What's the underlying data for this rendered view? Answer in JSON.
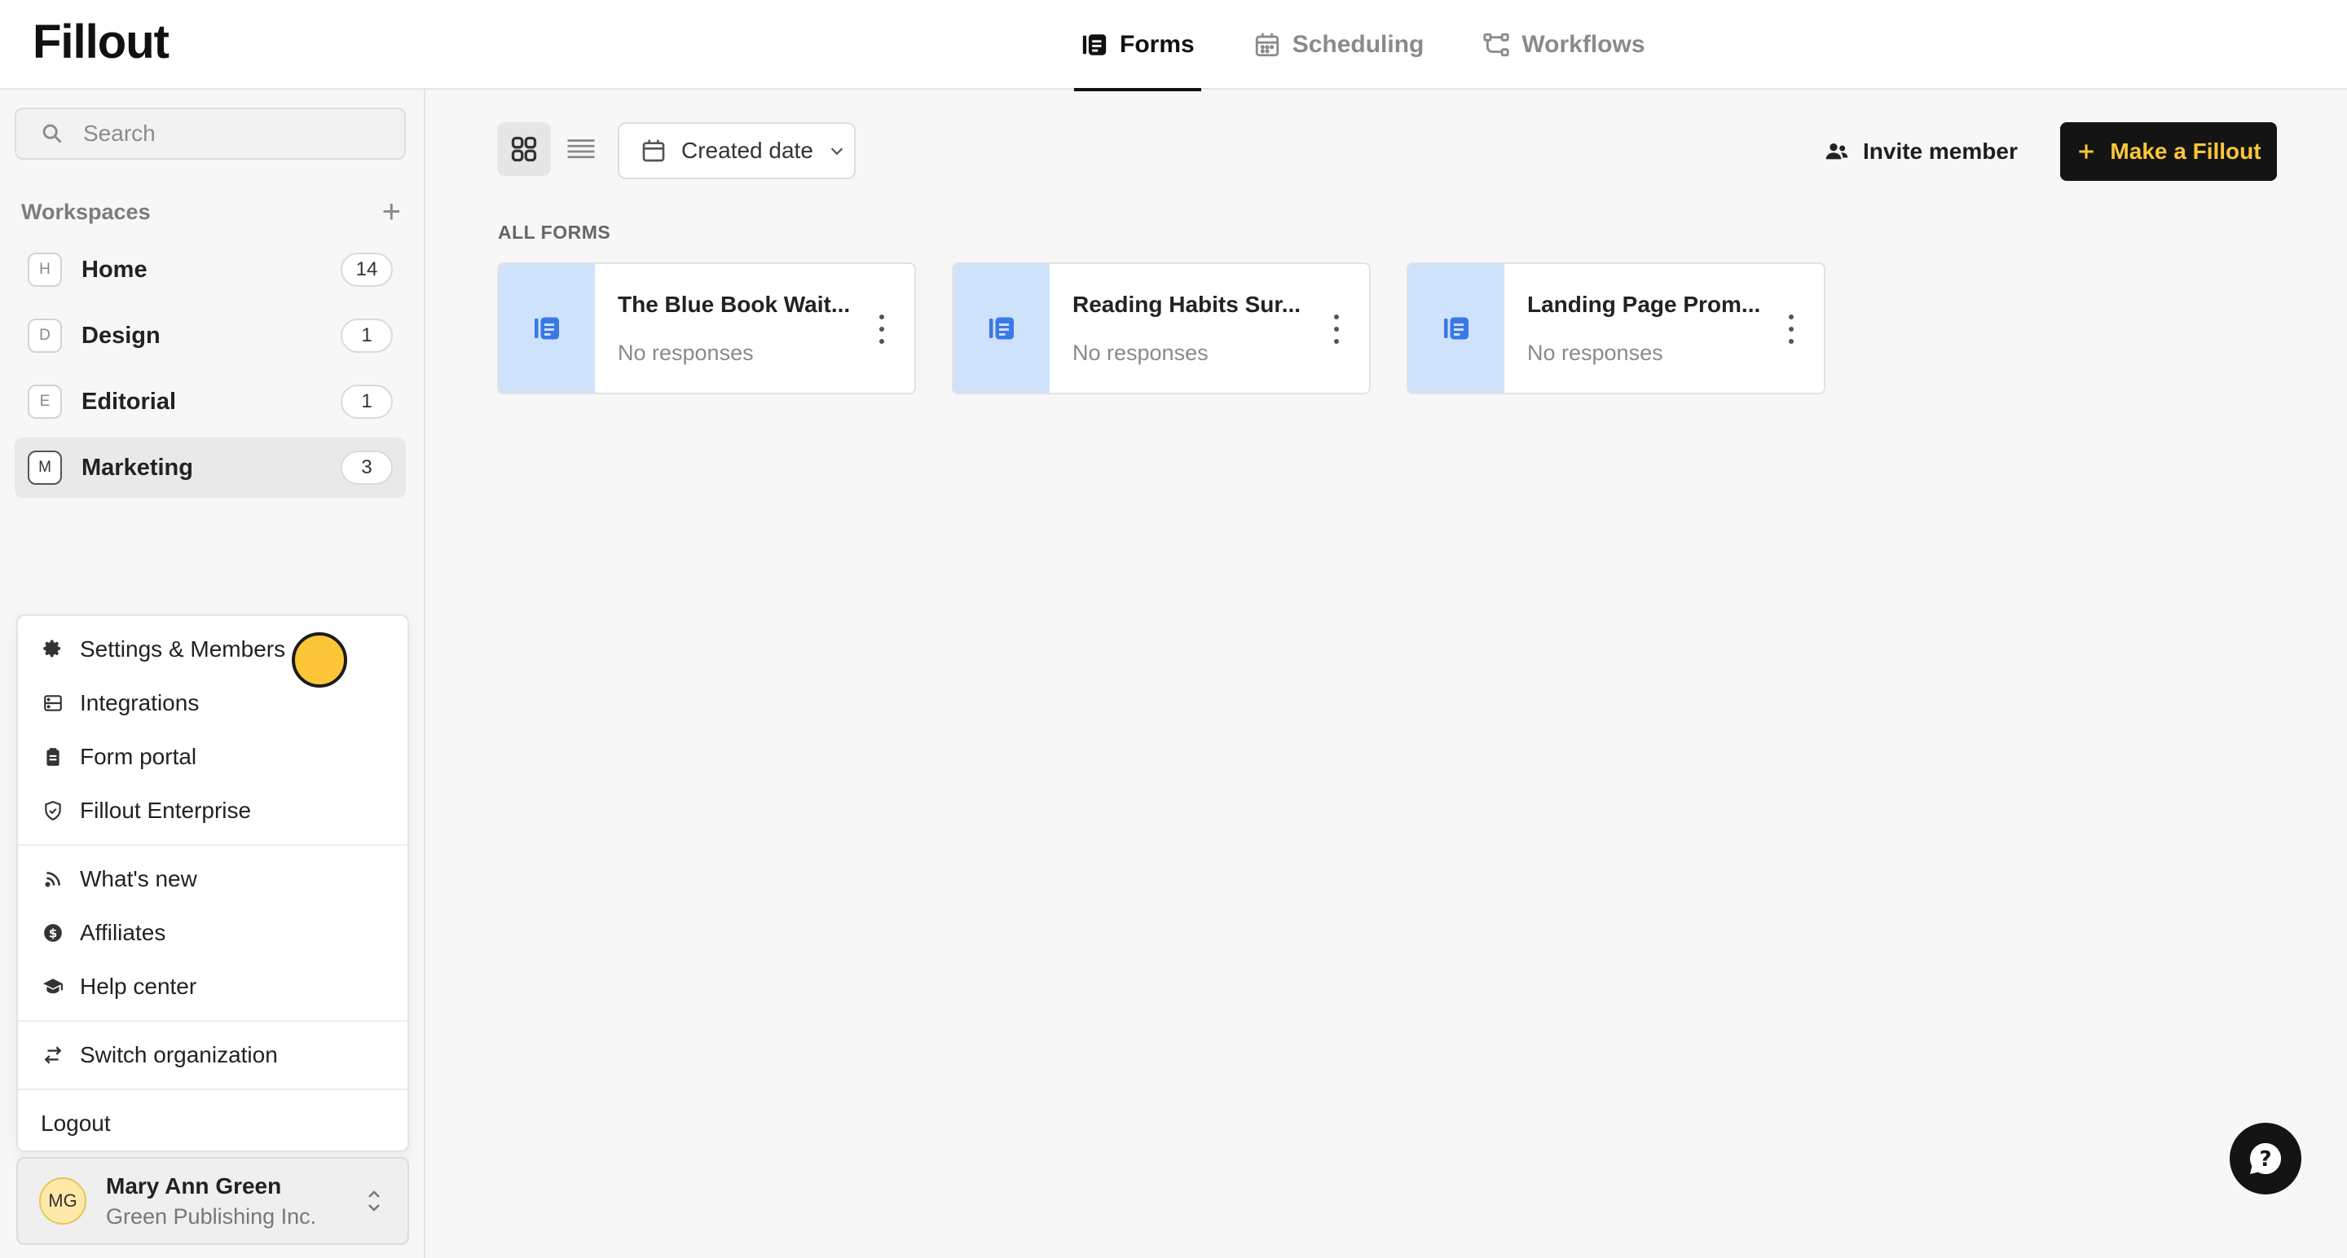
{
  "app": {
    "logo": "Fillout"
  },
  "nav": {
    "tabs": [
      {
        "label": "Forms",
        "icon": "form-icon",
        "active": true
      },
      {
        "label": "Scheduling",
        "icon": "calendar-icon",
        "active": false
      },
      {
        "label": "Workflows",
        "icon": "workflow-icon",
        "active": false
      }
    ]
  },
  "sidebar": {
    "search": {
      "placeholder": "Search"
    },
    "workspaces_title": "Workspaces",
    "workspaces": [
      {
        "letter": "H",
        "name": "Home",
        "count": "14",
        "active": false
      },
      {
        "letter": "D",
        "name": "Design",
        "count": "1",
        "active": false
      },
      {
        "letter": "E",
        "name": "Editorial",
        "count": "1",
        "active": false
      },
      {
        "letter": "M",
        "name": "Marketing",
        "count": "3",
        "active": true
      }
    ]
  },
  "menu": {
    "groups": [
      [
        {
          "label": "Settings & Members",
          "icon": "gear-icon"
        },
        {
          "label": "Integrations",
          "icon": "integrations-icon"
        },
        {
          "label": "Form portal",
          "icon": "clipboard-icon"
        },
        {
          "label": "Fillout Enterprise",
          "icon": "shield-icon"
        }
      ],
      [
        {
          "label": "What's new",
          "icon": "rss-icon"
        },
        {
          "label": "Affiliates",
          "icon": "dollar-icon"
        },
        {
          "label": "Help center",
          "icon": "graduation-cap-icon"
        }
      ],
      [
        {
          "label": "Switch organization",
          "icon": "switch-icon"
        }
      ],
      [
        {
          "label": "Logout",
          "icon": ""
        }
      ]
    ]
  },
  "user": {
    "initials": "MG",
    "name": "Mary Ann Green",
    "org": "Green Publishing Inc."
  },
  "toolbar": {
    "sort_label": "Created date",
    "invite_label": "Invite member",
    "make_label": "Make a Fillout"
  },
  "forms": {
    "section_label": "ALL FORMS",
    "items": [
      {
        "title": "The Blue Book Wait...",
        "subtitle": "No responses"
      },
      {
        "title": "Reading Habits Sur...",
        "subtitle": "No responses"
      },
      {
        "title": "Landing Page Prom...",
        "subtitle": "No responses"
      }
    ]
  },
  "colors": {
    "accent_yellow": "#fcc638",
    "form_thumb_bg": "#cfe2fb",
    "form_icon": "#3b78e7",
    "dark": "#141414"
  }
}
